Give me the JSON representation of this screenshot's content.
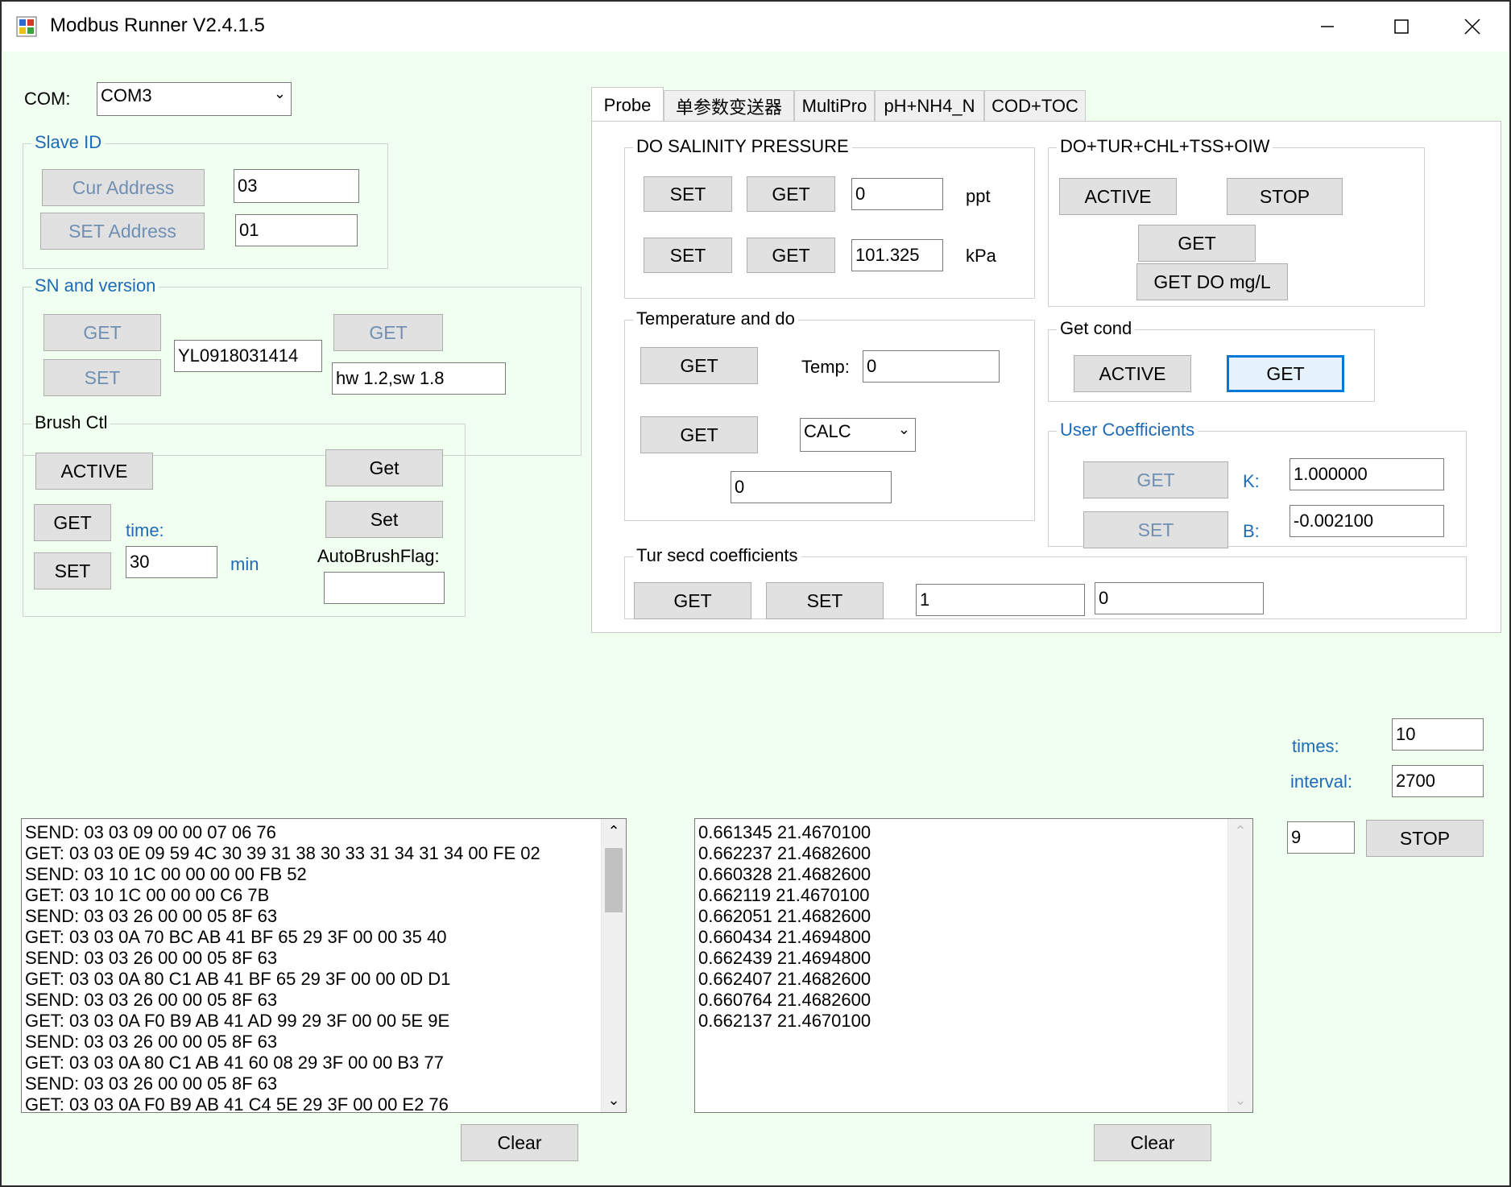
{
  "window": {
    "title": "Modbus Runner V2.4.1.5"
  },
  "com": {
    "label": "COM:",
    "value": "COM3"
  },
  "slave_id": {
    "title": "Slave ID",
    "cur_address_btn": "Cur Address",
    "cur_address_value": "03",
    "set_address_btn": "SET Address",
    "set_address_value": "01"
  },
  "sn_version": {
    "title": "SN and version",
    "get_sn_btn": "GET",
    "set_sn_btn": "SET",
    "sn_value": "YL0918031414",
    "get_version_btn": "GET",
    "version_value": "hw 1.2,sw 1.8"
  },
  "brush_ctl": {
    "title": "Brush Ctl",
    "active_btn": "ACTIVE",
    "get_btn": "GET",
    "set_btn": "SET",
    "time_label": "time:",
    "time_value": "30",
    "min_label": "min",
    "flag_get_btn": "Get",
    "flag_set_btn": "Set",
    "flag_label": "AutoBrushFlag:",
    "flag_value": ""
  },
  "tabs": [
    "Probe",
    "单参数变送器",
    "MultiPro",
    "pH+NH4_N",
    "COD+TOC"
  ],
  "probe": {
    "do_salinity": {
      "title": "DO SALINITY PRESSURE",
      "set1": "SET",
      "get1": "GET",
      "salinity_value": "0",
      "salinity_unit": "ppt",
      "set2": "SET",
      "get2": "GET",
      "pressure_value": "101.325",
      "pressure_unit": "kPa"
    },
    "do_tur": {
      "title": "DO+TUR+CHL+TSS+OIW",
      "active_btn": "ACTIVE",
      "stop_btn": "STOP",
      "get_btn": "GET",
      "get_do_btn": "GET DO mg/L"
    },
    "temp_do": {
      "title": "Temperature and do",
      "get_temp_btn": "GET",
      "temp_label": "Temp:",
      "temp_value": "0",
      "get_do_btn": "GET",
      "mode_value": "CALC",
      "do_value": "0"
    },
    "get_cond": {
      "title": "Get cond",
      "active_btn": "ACTIVE",
      "get_btn": "GET"
    },
    "user_coeff": {
      "title": "User Coefficients",
      "get_btn": "GET",
      "k_label": "K:",
      "k_value": "1.000000",
      "set_btn": "SET",
      "b_label": "B:",
      "b_value": "-0.002100"
    },
    "tur_secd": {
      "title": "Tur secd coefficients",
      "get_btn": "GET",
      "set_btn": "SET",
      "value1": "1",
      "value2": "0"
    }
  },
  "loop": {
    "times_label": "times:",
    "times_value": "10",
    "interval_label": "interval:",
    "interval_value": "2700",
    "count_value": "9",
    "stop_btn": "STOP"
  },
  "log_left": [
    "SEND: 03 03 09 00 00 07 06 76",
    "GET: 03 03 0E 09 59 4C 30 39 31 38 30 33 31 34 31 34 00 FE 02",
    "SEND: 03 10 1C 00 00 00 00 FB 52",
    "GET: 03 10 1C 00 00 00 C6 7B",
    "SEND: 03 03 26 00 00 05 8F 63",
    "GET: 03 03 0A 70 BC AB 41 BF 65 29 3F 00 00 35 40",
    "SEND: 03 03 26 00 00 05 8F 63",
    "GET: 03 03 0A 80 C1 AB 41 BF 65 29 3F 00 00 0D D1",
    "SEND: 03 03 26 00 00 05 8F 63",
    "GET: 03 03 0A F0 B9 AB 41 AD 99 29 3F 00 00 5E 9E",
    "SEND: 03 03 26 00 00 05 8F 63",
    "GET: 03 03 0A 80 C1 AB 41 60 08 29 3F 00 00 B3 77",
    "SEND: 03 03 26 00 00 05 8F 63",
    "GET: 03 03 0A F0 B9 AB 41 C4 5E 29 3F 00 00 E2 76"
  ],
  "log_right": [
    "0.661345 21.4670100",
    "0.662237 21.4682600",
    "0.660328 21.4682600",
    "0.662119 21.4670100",
    "0.662051 21.4682600",
    "0.660434 21.4694800",
    "0.662439 21.4694800",
    "0.662407 21.4682600",
    "0.660764 21.4682600",
    "0.662137 21.4670100"
  ],
  "clear_left": "Clear",
  "clear_right": "Clear"
}
